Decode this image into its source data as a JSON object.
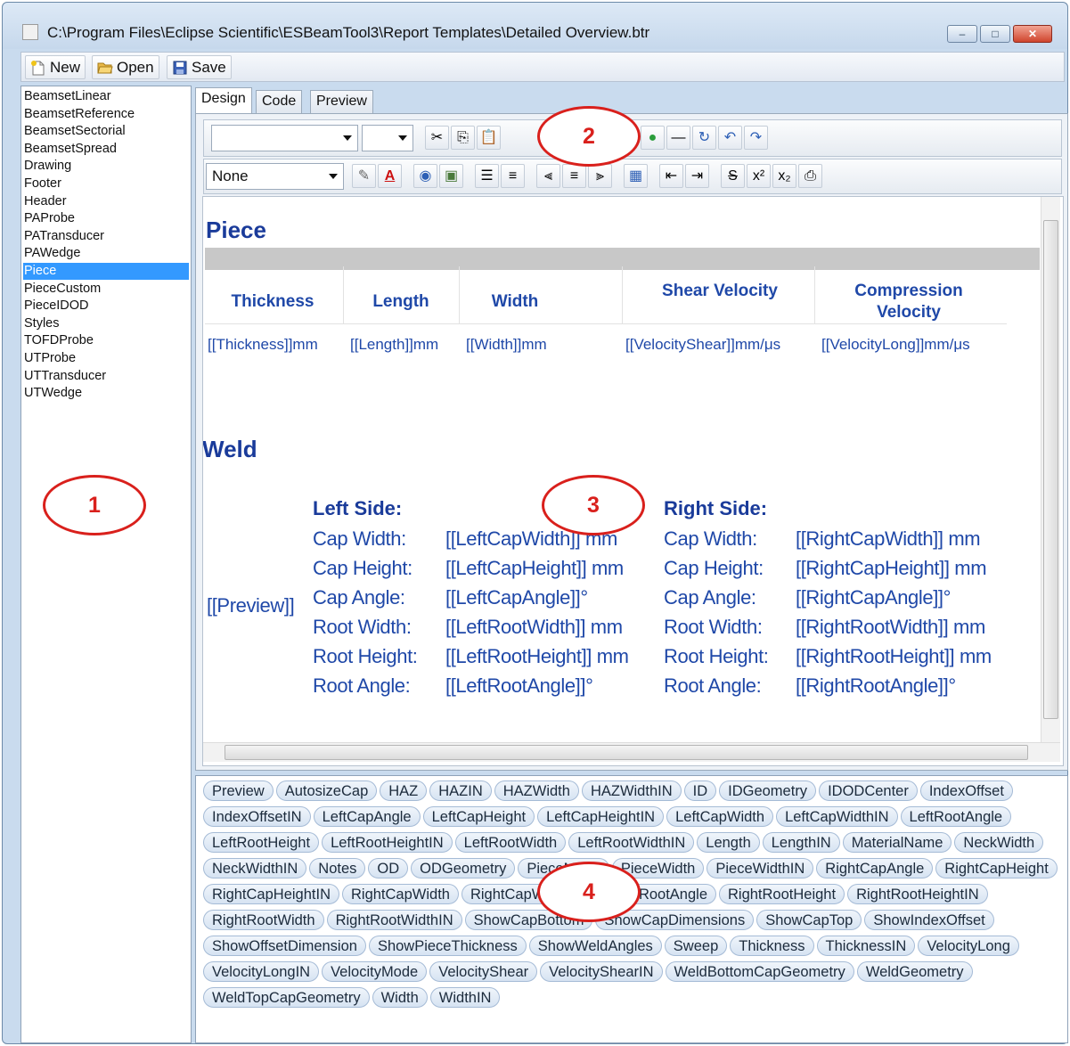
{
  "window": {
    "title": "C:\\Program Files\\Eclipse Scientific\\ESBeamTool3\\Report Templates\\Detailed Overview.btr",
    "minimize": "–",
    "maximize": "□",
    "close": "✕"
  },
  "toolbar": {
    "new_label": "New",
    "open_label": "Open",
    "save_label": "Save"
  },
  "template_list": {
    "items": [
      "BeamsetLinear",
      "BeamsetReference",
      "BeamsetSectorial",
      "BeamsetSpread",
      "Drawing",
      "Footer",
      "Header",
      "PAProbe",
      "PATransducer",
      "PAWedge",
      "Piece",
      "PieceCustom",
      "PieceIDOD",
      "Styles",
      "TOFDProbe",
      "UTProbe",
      "UTTransducer",
      "UTWedge"
    ],
    "selected": "Piece"
  },
  "tabs": [
    "Design",
    "Code",
    "Preview"
  ],
  "active_tab": "Design",
  "format_bar": {
    "style_value": "None"
  },
  "callouts": [
    "1",
    "2",
    "3",
    "4"
  ],
  "document": {
    "piece_title": "Piece",
    "columns": [
      {
        "header": "Thickness",
        "value": "[[Thickness]]mm"
      },
      {
        "header": "Length",
        "value": "[[Length]]mm"
      },
      {
        "header": "Width",
        "value": "[[Width]]mm"
      },
      {
        "header": "Shear Velocity",
        "value": "[[VelocityShear]]mm/μs"
      },
      {
        "header": "Compression Velocity",
        "value": "[[VelocityLong]]mm/μs"
      }
    ],
    "weld_title": "Weld",
    "preview_tag": "[[Preview]]",
    "left_side": {
      "title": "Left Side:",
      "rows": [
        {
          "label": "Cap Width:",
          "value": "[[LeftCapWidth]] mm"
        },
        {
          "label": "Cap Height:",
          "value": "[[LeftCapHeight]] mm"
        },
        {
          "label": "Cap Angle:",
          "value": "[[LeftCapAngle]]°"
        },
        {
          "label": "Root Width:",
          "value": "[[LeftRootWidth]] mm"
        },
        {
          "label": "Root Height:",
          "value": "[[LeftRootHeight]] mm"
        },
        {
          "label": "Root Angle:",
          "value": "[[LeftRootAngle]]°"
        }
      ]
    },
    "right_side": {
      "title": "Right Side:",
      "rows": [
        {
          "label": "Cap Width:",
          "value": "[[RightCapWidth]] mm"
        },
        {
          "label": "Cap Height:",
          "value": "[[RightCapHeight]] mm"
        },
        {
          "label": "Cap Angle:",
          "value": "[[RightCapAngle]]°"
        },
        {
          "label": "Root Width:",
          "value": "[[RightRootWidth]] mm"
        },
        {
          "label": "Root Height:",
          "value": "[[RightRootHeight]] mm"
        },
        {
          "label": "Root Angle:",
          "value": "[[RightRootAngle]]°"
        }
      ]
    }
  },
  "fields": [
    "Preview",
    "AutosizeCap",
    "HAZ",
    "HAZIN",
    "HAZWidth",
    "HAZWidthIN",
    "ID",
    "IDGeometry",
    "IDODCenter",
    "IndexOffset",
    "IndexOffsetIN",
    "LeftCapAngle",
    "LeftCapHeight",
    "LeftCapHeightIN",
    "LeftCapWidth",
    "LeftCapWidthIN",
    "LeftRootAngle",
    "LeftRootHeight",
    "LeftRootHeightIN",
    "LeftRootWidth",
    "LeftRootWidthIN",
    "Length",
    "LengthIN",
    "MaterialName",
    "NeckWidth",
    "NeckWidthIN",
    "Notes",
    "OD",
    "ODGeometry",
    "PieceMode",
    "PieceWidth",
    "PieceWidthIN",
    "RightCapAngle",
    "RightCapHeight",
    "RightCapHeightIN",
    "RightCapWidth",
    "RightCapWidthIN",
    "RightRootAngle",
    "RightRootHeight",
    "RightRootHeightIN",
    "RightRootWidth",
    "RightRootWidthIN",
    "ShowCapBottom",
    "ShowCapDimensions",
    "ShowCapTop",
    "ShowIndexOffset",
    "ShowOffsetDimension",
    "ShowPieceThickness",
    "ShowWeldAngles",
    "Sweep",
    "Thickness",
    "ThicknessIN",
    "VelocityLong",
    "VelocityLongIN",
    "VelocityMode",
    "VelocityShear",
    "VelocityShearIN",
    "WeldBottomCapGeometry",
    "WeldGeometry",
    "WeldTopCapGeometry",
    "Width",
    "WidthIN"
  ]
}
